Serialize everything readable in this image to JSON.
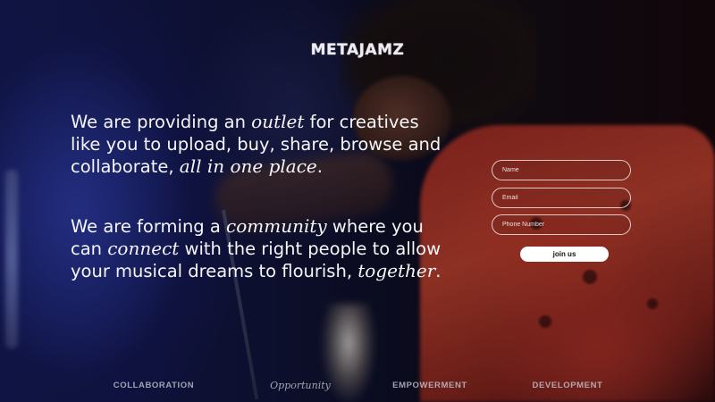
{
  "brand": {
    "logo_text": "METAJAMZ"
  },
  "intro": {
    "p1": {
      "t1": "We are providing an ",
      "e1": "outlet",
      "t2": " for creatives like you to upload, buy, share, browse and collaborate, ",
      "e2": "all in one place",
      "t3": "."
    },
    "p2": {
      "t1": "We are forming a ",
      "e1": "community",
      "t2": " where you can ",
      "e2": "connect",
      "t3": " with the right people to allow your musical dreams to flourish, ",
      "e3": "together",
      "t4": "."
    }
  },
  "signup": {
    "name_placeholder": "Name",
    "email_placeholder": "Email",
    "phone_placeholder": "Phone Number",
    "submit_label": "join us"
  },
  "footer": {
    "items": [
      "COLLABORATION",
      "Opportunity",
      "EMPOWERMENT",
      "DEVELOPMENT"
    ]
  },
  "colors": {
    "text": "#ffffff",
    "button_bg": "#ffffff",
    "button_text": "#111111",
    "footer_text": "#d2d4de"
  }
}
